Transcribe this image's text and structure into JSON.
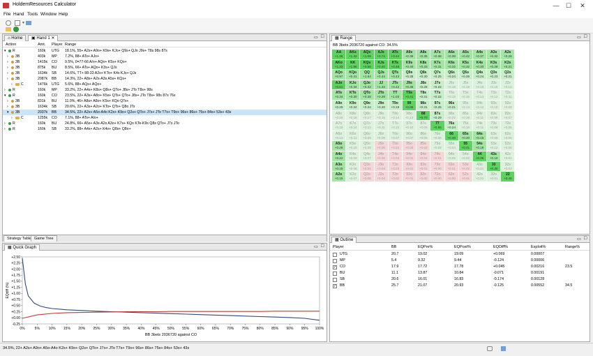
{
  "app": {
    "title": "HoldemResources Calculator"
  },
  "menu": [
    "File",
    "Hand",
    "Tools",
    "Window",
    "Help"
  ],
  "left_tabs": [
    "Home",
    "Hand 1"
  ],
  "tree": {
    "headers": [
      "Action",
      "Amt.",
      "Player",
      "Range"
    ],
    "rows": [
      {
        "action": "R",
        "amt": "160k",
        "player": "UTG",
        "range": "18.1%, 55+ A2s+ A9o+ K9s+ KJo+ Q9s+ QJo J9s+ T8s 98s 87s"
      },
      {
        "action": "3B",
        "amt": "403k",
        "player": "MP",
        "range": "7.2%, 88+ ATs+ AJo+"
      },
      {
        "action": "3B",
        "amt": "1415k",
        "player": "CO",
        "range": "9.5%, 0=77-66 A/o+ AQo+ K5s+ KQo+"
      },
      {
        "action": "3B",
        "amt": "875k",
        "player": "BU",
        "range": "8.5%, 66+ ATs+ AQo+ K3s+ QJs"
      },
      {
        "action": "3B",
        "amt": "1634k",
        "player": "SB",
        "range": "14.6%, TT+ 88-33 A2s+ KTo+ K4s KJs+ QJs"
      },
      {
        "action": "3B",
        "amt": "2087k",
        "player": "BB",
        "range": "14.3%, 22+ A8s+ A2s-A3s A5s+ KQs+"
      },
      {
        "action": "C",
        "amt": "1476k",
        "player": "UTG",
        "range": "5.6%, 88+ AQs+ AQo+"
      },
      {
        "action": "R",
        "amt": "160k",
        "player": "MP",
        "range": "33.2%, 22+ A4s+ K8s+ Q8s+ QTo+ J8s+ JTo T8s+ 98s"
      },
      {
        "action": "R",
        "amt": "160k",
        "player": "CO",
        "range": "23.5%, 22+ A3s+ A8o+ K5s+ QTs+ QTo+ J8s+ JTo T8s+ 98s 87s 76s"
      },
      {
        "action": "3B",
        "amt": "831k",
        "player": "BU",
        "range": "11.0%, 46+ A8s+ A8o+ K5s+ KQo QTs+"
      },
      {
        "action": "3B",
        "amt": "1634k",
        "player": "SB",
        "range": "20.6%, 22+ A3s+ A2o+ KTo+ QTs+ Q8o JTs"
      },
      {
        "action": "3B",
        "amt": "2037k",
        "player": "BB",
        "range": "34.5%, 22+ A2s+ A5o-A4o K2s+ K9o+ Q2s+ QTo+ J7s+ JTo T7s+ T9o+ 96s+ 86s+ 75s+ 84s+ 53s+ 43s",
        "sel": true
      },
      {
        "action": "C",
        "amt": "1255k",
        "player": "CO",
        "range": "7.1%, 88+ ATs+ A/o+"
      },
      {
        "action": "R",
        "amt": "160k",
        "player": "BU",
        "range": "24.8%, 66+ A5s+ A3s-A2s A3o+ K7s+ KQo KTe-K9s Q8s QTo+ J7s JTo"
      },
      {
        "action": "R",
        "amt": "160k",
        "player": "SB",
        "range": "33.2%, 88+ A4s+ A2s+ K4o+ Q8s+ Q8o+"
      }
    ]
  },
  "left_bottom_tabs": [
    "Strategy Table",
    "Game Tree"
  ],
  "quick_graph": {
    "title": "Quick Graph",
    "ylabel": "EQdiff (%)",
    "xlabel": "BB 3bets 2036720 against CO",
    "yticks": [
      "+2.50",
      "+2.25",
      "+2.00",
      "+1.75",
      "+1.50",
      "+1.25",
      "+1.00",
      "+0.75",
      "+0.50",
      "+0.25",
      "+0.00",
      "-0.25"
    ],
    "xticks": [
      "0%",
      "5%",
      "10%",
      "15%",
      "20%",
      "25%",
      "30%",
      "35%",
      "40%",
      "45%",
      "50%",
      "55%",
      "60%",
      "65%",
      "70%",
      "75%",
      "80%",
      "85%",
      "90%",
      "95%",
      "100%"
    ]
  },
  "chart_data": {
    "type": "line",
    "xlabel": "BB 3bets 2036720 against CO",
    "ylabel": "EQdiff (%)",
    "ylim": [
      -0.25,
      2.5
    ],
    "xlim": [
      0,
      100
    ],
    "series": [
      {
        "color": "#2d4b7a",
        "x": [
          0,
          1,
          2,
          4,
          6,
          8,
          10,
          15,
          20,
          25,
          30,
          35,
          40,
          45,
          50,
          55,
          60,
          65,
          70,
          75,
          80,
          85,
          90,
          95,
          100
        ],
        "y": [
          2.45,
          1.4,
          0.9,
          0.6,
          0.48,
          0.42,
          0.38,
          0.33,
          0.3,
          0.27,
          0.25,
          0.23,
          0.21,
          0.19,
          0.17,
          0.15,
          0.13,
          0.11,
          0.09,
          0.07,
          0.05,
          0.03,
          0.01,
          -0.02,
          -0.1
        ]
      },
      {
        "color": "#c23a3a",
        "x": [
          0,
          5,
          10,
          15,
          20,
          25,
          30,
          35,
          40,
          45,
          50,
          55,
          60,
          65,
          70,
          75,
          80,
          85,
          90,
          95,
          100
        ],
        "y": [
          -0.02,
          0.12,
          0.18,
          0.21,
          0.22,
          0.23,
          0.24,
          0.25,
          0.25,
          0.25,
          0.26,
          0.26,
          0.26,
          0.26,
          0.26,
          0.26,
          0.26,
          0.27,
          0.27,
          0.27,
          0.27
        ]
      }
    ]
  },
  "range_panel": {
    "tab": "Range",
    "caption": "BB 3bets 2036720 against CO: 34.5%",
    "colors": {
      "in_strong": "#5fd35f",
      "in": "#a3e6a3",
      "in_light": "#c8f0c8",
      "mixed": "#ddf2dd",
      "out": "#f6d6d6",
      "neutral": "#eef3ee"
    },
    "cells": [
      [
        "AA|+1.36",
        "AKs|+1.42",
        "AQs|+1.08",
        "AJs|+0.74",
        "ATs|+0.44",
        "A9s|+0.36",
        "A8s|+0.35",
        "A7s|+0.38",
        "A6s|+0.38",
        "A5s|+0.42",
        "A4s|+0.37",
        "A3s|+0.32",
        "A2s|+0.28"
      ],
      [
        "AKo|+1.33",
        "KK|+1.96",
        "KQs|+0.58",
        "KJs|+0.40",
        "KTs|+0.48",
        "K9s|+0.40",
        "K8s|+0.33",
        "K7s|+0.31",
        "K6s|+0.32",
        "K5s|+0.32",
        "K4s|+0.30",
        "K3s|+0.29",
        "K2s|+0.21"
      ],
      [
        "AQo|+0.97",
        "KQo|+0.41",
        "QQ|+1.64",
        "QJs|+0.44",
        "QTs|+0.43",
        "Q9s|+0.38",
        "Q8s|+0.30",
        "Q7s|+0.25",
        "Q6s|+0.24",
        "Q5s|+0.26",
        "Q4s|+0.24",
        "Q3s|+0.23",
        "Q2s|+0.21"
      ],
      [
        "AJo|+0.81",
        "KJo|+0.34",
        "QJo|+0.33",
        "JJ|+1.33",
        "JTs|+0.42",
        "J9s|+0.36",
        "J8s|+0.28",
        "J7s|+0.22",
        "J6s|+0.18",
        "J5s|+0.19",
        "J4s|+0.16",
        "J3s|+0.15",
        "J2s|+0.14"
      ],
      [
        "ATo|+0.34",
        "KTo|+0.30",
        "QTo|+0.38",
        "JTo|+0.28",
        "TT|+1.03",
        "T9s|+0.41",
        "T8s|+0.31",
        "T7s|+0.22",
        "T6s|+0.18",
        "T5s|+0.15",
        "T4s|+0.13",
        "T3s|+0.12",
        "T2s|+0.11"
      ],
      [
        "A9o|+0.29",
        "K9o|+0.24",
        "Q9o|+0.24",
        "J9o|+0.20",
        "T9o|+0.19",
        "99|+0.85",
        "98s|+0.31",
        "97s|+0.25",
        "96s|+0.21",
        "95s|+0.14",
        "94s|+0.12",
        "93s|+0.10",
        "92s|+0.09"
      ],
      [
        "A8o|+0.20",
        "K8o|+0.18",
        "Q8o|+0.17",
        "J8o|+0.15",
        "T8o|+0.14",
        "98o|+0.13",
        "88|+0.70",
        "87s|+0.29",
        "86s|+0.22",
        "85s|+0.16",
        "84s|+0.11",
        "83s|+0.09",
        "82s|+0.07"
      ],
      [
        "A7o|+0.16",
        "K7o|+0.14",
        "Q7o|+0.12",
        "J7o|+0.11",
        "T7o|+0.10",
        "97o|+0.10",
        "87o|+0.08",
        "77|+0.56",
        "76s|+0.24",
        "75s|+0.18",
        "74s|+0.11",
        "73s|+0.08",
        "72s|+0.05"
      ],
      [
        "A6o|+0.13",
        "K6o|+0.11",
        "Q6o|+0.09",
        "J6o|+0.08",
        "T6o|+0.07",
        "96o|+0.07",
        "86o|+0.06",
        "76o|+0.05",
        "66|+0.48",
        "65s|+0.20",
        "64s|+0.15",
        "63s|+0.09",
        "62s|+0.06"
      ],
      [
        "A5o|+0.26",
        "K5o|+0.10",
        "Q5o|+0.08",
        "J5o|+0.06",
        "T5o|+0.04",
        "95o|+0.03",
        "85o|+0.03",
        "75o|+0.02",
        "65o|+0.04",
        "55|+0.41",
        "54s|+0.18",
        "53s|+0.12",
        "52s|+0.06"
      ],
      [
        "A4o|+0.22",
        "K4o|+0.09",
        "Q4o|+0.07",
        "J4o|+0.05",
        "T4o|+0.03",
        "94o|+0.02",
        "84o|+0.01",
        "74o|+0.01",
        "64o|+0.02",
        "54o|+0.03",
        "44|+0.35",
        "43s|+0.10",
        "42s|+0.04"
      ],
      [
        "A3o|+0.18",
        "K3o|+0.08",
        "Q3o|+0.06",
        "J3o|+0.04",
        "T3o|+0.03",
        "93o|+0.01",
        "83o|+0.01",
        "73o|+0.00",
        "63o|+0.01",
        "53o|+0.02",
        "43o|+0.01",
        "33|+0.30",
        "32s|+0.03"
      ],
      [
        "A2o|+0.15",
        "K2o|+0.07",
        "Q2o|+0.05",
        "J2o|+0.04",
        "T2o|+0.02",
        "92o|+0.01",
        "82o|+0.00",
        "72o|+0.00",
        "62o|+0.00",
        "52o|+0.01",
        "42o|+0.01",
        "32o|+0.01",
        "22|+0.46"
      ]
    ],
    "cell_class": [
      "SSSSSAAAAAAAA",
      "SSSSSAAAAAAAA",
      "AAAAALLLLLLLL",
      "SAAAAALLMMMMM",
      "AAAAASLLMMMMM",
      "LLLLLSLLLMMMM",
      "MMMMMMSLMMMMM",
      "MMMMMMMSLMMMM",
      "MMMMMMMMSAAMM",
      "AMMOOOOMMSAMM",
      "AMMOOOOOMMSAM",
      "AMOOOOOOOOMSM",
      "AMOOOOOOOOMMS"
    ]
  },
  "outline": {
    "tab": "Outline",
    "headers": [
      "Player",
      "BB",
      "EQPre%",
      "EQPost%",
      "EQDiff%",
      "Exploit%",
      "Range%"
    ],
    "rows": [
      {
        "checked": false,
        "player": "UTG",
        "bb": "20.7",
        "eqpre": "19.02",
        "eqpost": "19.09",
        "eqdiff": "+0.069",
        "exploit": "0.00007",
        "range": ""
      },
      {
        "checked": false,
        "player": "MP",
        "bb": "5.4",
        "eqpre": "9.32",
        "eqpost": "9.44",
        "eqdiff": "-0.124",
        "exploit": "0.00006",
        "range": ""
      },
      {
        "checked": true,
        "player": "CO",
        "bb": "17.9",
        "eqpre": "17.72",
        "eqpost": "17.78",
        "eqdiff": "+0.045",
        "exploit": "0.00216",
        "range": "23.5"
      },
      {
        "checked": false,
        "player": "BU",
        "bb": "11.1",
        "eqpre": "13.87",
        "eqpost": "10.84",
        "eqdiff": "-0.071",
        "exploit": "0.00191",
        "range": ""
      },
      {
        "checked": false,
        "player": "SB",
        "bb": "20.6",
        "eqpre": "16.01",
        "eqpost": "16.83",
        "eqdiff": "-0.174",
        "exploit": "0.00128",
        "range": ""
      },
      {
        "checked": true,
        "player": "BB",
        "bb": "25.7",
        "eqpre": "21.07",
        "eqpost": "20.93",
        "eqdiff": "-0.125",
        "exploit": "0.00552",
        "range": "34.5"
      }
    ]
  },
  "status": {
    "text": "34.5%, 22+ A2s+ A9o+ A5o-A4o K2s+ K9o+ Q2s+ QTo+ J7o+ JTo T7s+ T9o+ 96s+ 86s+ 75s+ 84s+ 53s+ 43s"
  }
}
